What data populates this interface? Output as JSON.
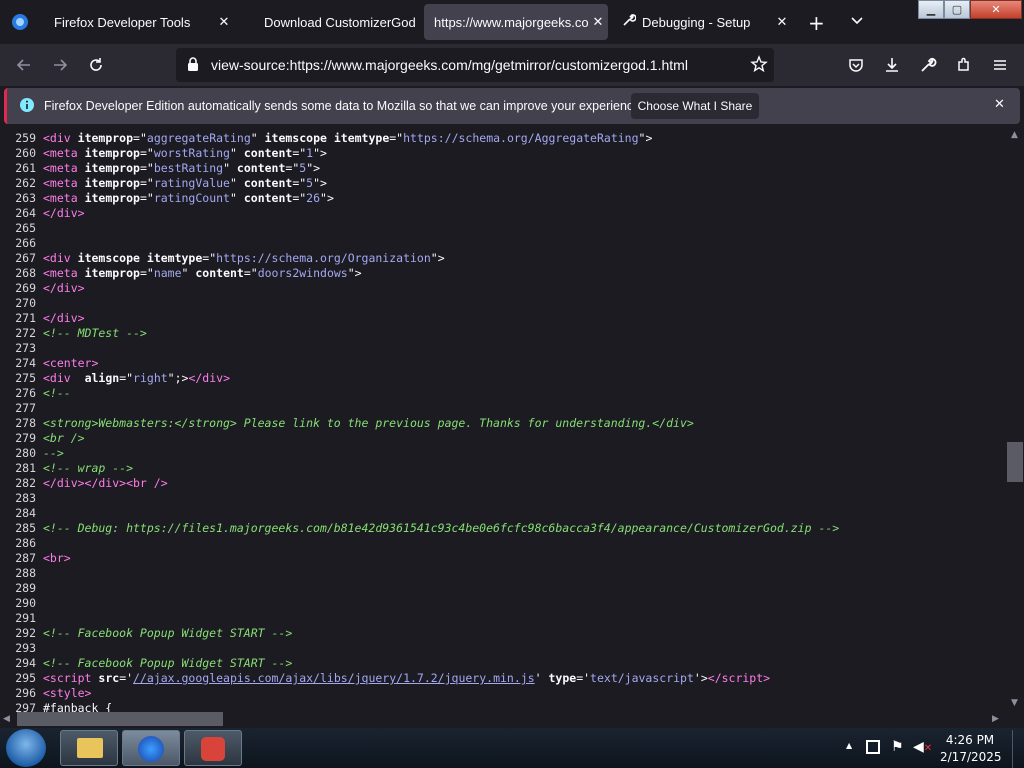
{
  "tabs": [
    {
      "label": "Firefox Developer Tools",
      "active": false
    },
    {
      "label": "Download CustomizerGod",
      "active": false
    },
    {
      "label": "https://www.majorgeeks.com",
      "active": true
    },
    {
      "label": "Debugging - Setup",
      "active": false
    }
  ],
  "url": "view-source:https://www.majorgeeks.com/mg/getmirror/customizergod.1.html",
  "notification": {
    "text": "Firefox Developer Edition automatically sends some data to Mozilla so that we can improve your experience.",
    "button": "Choose What I Share"
  },
  "source_lines": [
    {
      "n": "259",
      "html": "<span class=\"tag\">&lt;div</span> <span class=\"attr\">itemprop</span>=\"<span class=\"val\">aggregateRating</span>\" <span class=\"attr\">itemscope</span> <span class=\"attr\">itemtype</span>=\"<span class=\"val\">https://schema.org/AggregateRating</span>\"&gt;"
    },
    {
      "n": "260",
      "html": "<span class=\"tag\">&lt;meta</span> <span class=\"attr\">itemprop</span>=\"<span class=\"val\">worstRating</span>\" <span class=\"attr\">content</span>=\"<span class=\"val\">1</span>\"&gt;"
    },
    {
      "n": "261",
      "html": "<span class=\"tag\">&lt;meta</span> <span class=\"attr\">itemprop</span>=\"<span class=\"val\">bestRating</span>\" <span class=\"attr\">content</span>=\"<span class=\"val\">5</span>\"&gt;"
    },
    {
      "n": "262",
      "html": "<span class=\"tag\">&lt;meta</span> <span class=\"attr\">itemprop</span>=\"<span class=\"val\">ratingValue</span>\" <span class=\"attr\">content</span>=\"<span class=\"val\">5</span>\"&gt;"
    },
    {
      "n": "263",
      "html": "<span class=\"tag\">&lt;meta</span> <span class=\"attr\">itemprop</span>=\"<span class=\"val\">ratingCount</span>\" <span class=\"attr\">content</span>=\"<span class=\"val\">26</span>\"&gt;"
    },
    {
      "n": "264",
      "html": "<span class=\"tag\">&lt;/div&gt;</span>"
    },
    {
      "n": "265",
      "html": ""
    },
    {
      "n": "266",
      "html": ""
    },
    {
      "n": "267",
      "html": "<span class=\"tag\">&lt;div</span> <span class=\"attr\">itemscope</span> <span class=\"attr\">itemtype</span>=\"<span class=\"val\">https://schema.org/Organization</span>\"&gt;"
    },
    {
      "n": "268",
      "html": "<span class=\"tag\">&lt;meta</span> <span class=\"attr\">itemprop</span>=\"<span class=\"val\">name</span>\" <span class=\"attr\">content</span>=\"<span class=\"val\">doors2windows</span>\"&gt;"
    },
    {
      "n": "269",
      "html": "<span class=\"tag\">&lt;/div&gt;</span>"
    },
    {
      "n": "270",
      "html": ""
    },
    {
      "n": "271",
      "html": "<span class=\"tag\">&lt;/div&gt;</span>"
    },
    {
      "n": "272",
      "html": "<span class=\"cmt\">&lt;!-- MDTest --&gt;</span>"
    },
    {
      "n": "273",
      "html": ""
    },
    {
      "n": "274",
      "html": "<span class=\"tag\">&lt;center&gt;</span>"
    },
    {
      "n": "275",
      "html": "<span class=\"tag\">&lt;div</span>  <span class=\"attr\">align</span>=\"<span class=\"val\">right</span>\";&gt;<span class=\"tag\">&lt;/div&gt;</span>"
    },
    {
      "n": "276",
      "html": "<span class=\"cmt\">&lt;!--</span>"
    },
    {
      "n": "277",
      "html": ""
    },
    {
      "n": "278",
      "html": "<span class=\"cmt\">&lt;strong&gt;Webmasters:&lt;/strong&gt; Please link to the previous page. Thanks for understanding.&lt;/div&gt;</span>"
    },
    {
      "n": "279",
      "html": "<span class=\"cmt\">&lt;br /&gt;</span>"
    },
    {
      "n": "280",
      "html": "<span class=\"cmt\">--&gt;</span>"
    },
    {
      "n": "281",
      "html": "<span class=\"cmt\">&lt;!-- wrap --&gt;</span>"
    },
    {
      "n": "282",
      "html": "<span class=\"tag\">&lt;/div&gt;&lt;/div&gt;&lt;br /&gt;</span>"
    },
    {
      "n": "283",
      "html": ""
    },
    {
      "n": "284",
      "html": ""
    },
    {
      "n": "285",
      "html": "<span class=\"cmt\">&lt;!-- Debug: https://files1.majorgeeks.com/b81e42d9361541c93c4be0e6fcfc98c6bacca3f4/appearance/CustomizerGod.zip --&gt;</span>"
    },
    {
      "n": "286",
      "html": ""
    },
    {
      "n": "287",
      "html": "<span class=\"tag\">&lt;br&gt;</span>"
    },
    {
      "n": "288",
      "html": ""
    },
    {
      "n": "289",
      "html": ""
    },
    {
      "n": "290",
      "html": ""
    },
    {
      "n": "291",
      "html": ""
    },
    {
      "n": "292",
      "html": "<span class=\"cmt\">&lt;!-- Facebook Popup Widget START --&gt;</span>"
    },
    {
      "n": "293",
      "html": ""
    },
    {
      "n": "294",
      "html": "<span class=\"cmt\">&lt;!-- Facebook Popup Widget START --&gt;</span>"
    },
    {
      "n": "295",
      "html": "<span class=\"tag\">&lt;script</span> <span class=\"attr\">src</span>='<span class=\"lnk\">//ajax.googleapis.com/ajax/libs/jquery/1.7.2/jquery.min.js</span>' <span class=\"attr\">type</span>='<span class=\"val\">text/javascript</span>'&gt;<span class=\"tag\">&lt;/script&gt;</span>"
    },
    {
      "n": "296",
      "html": "<span class=\"tag\">&lt;style&gt;</span>"
    },
    {
      "n": "297",
      "html": "#fanback {"
    }
  ],
  "taskbar": {
    "time": "4:26 PM",
    "date": "2/17/2025"
  },
  "colors": {
    "accent": "#e02950",
    "tag": "#ff7de9",
    "value": "#a3a8f0",
    "comment": "#86de74"
  }
}
